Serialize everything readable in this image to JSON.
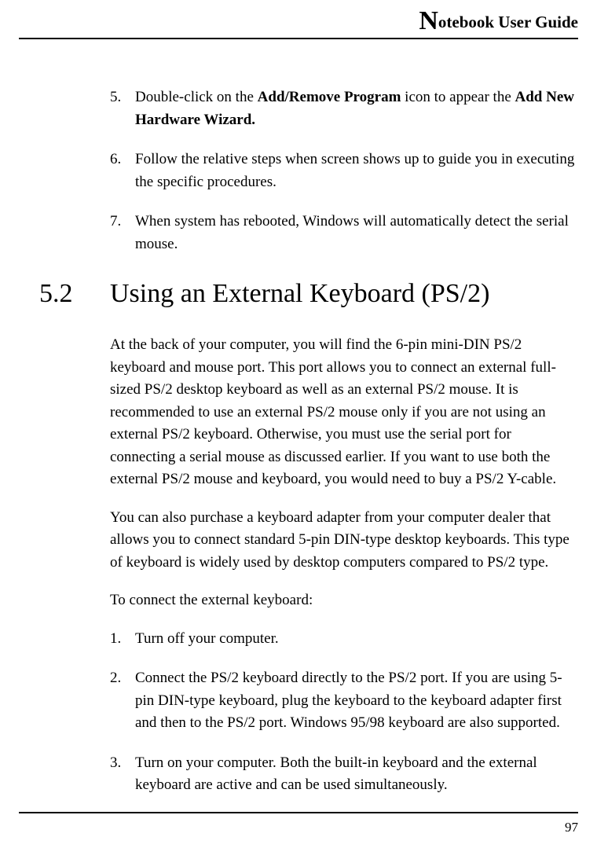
{
  "header": {
    "drop_cap": "N",
    "title_rest": "otebook User Guide"
  },
  "top_list": [
    {
      "num": "5.",
      "pre": "Double-click on the ",
      "bold1": "Add/Remove Program",
      "mid": " icon to appear the ",
      "bold2": "Add New Hardware Wizard.",
      "post": ""
    },
    {
      "num": "6.",
      "text": "Follow the relative steps when screen shows up to guide you in executing the specific procedures."
    },
    {
      "num": "7.",
      "text": "When system has rebooted, Windows will automatically detect the serial mouse."
    }
  ],
  "section": {
    "number": "5.2",
    "title": "Using an External Keyboard (PS/2)"
  },
  "paragraphs": [
    "At the back of your computer, you will find the 6-pin mini-DIN PS/2 keyboard and mouse port. This port allows you to connect an external full-sized PS/2 desktop keyboard as well as an external PS/2 mouse. It is recommended to use an external PS/2 mouse only if you are not using an external PS/2 keyboard. Otherwise, you must use the serial port for connecting a serial mouse as discussed earlier. If you want to use both the external PS/2 mouse and keyboard, you would need to buy a PS/2 Y-cable.",
    "You can also purchase a keyboard adapter from your computer dealer that allows you to connect standard 5-pin DIN-type desktop keyboards. This type of keyboard is widely used by desktop computers compared to PS/2 type.",
    "To connect the external keyboard:"
  ],
  "bottom_list": [
    {
      "num": "1.",
      "text": "Turn off your computer."
    },
    {
      "num": "2.",
      "text": "Connect the PS/2 keyboard directly to the PS/2 port. If you are using 5-pin DIN-type keyboard, plug the keyboard to the keyboard adapter first and then to the PS/2 port. Windows 95/98 keyboard are also supported."
    },
    {
      "num": "3.",
      "text": "Turn on your computer. Both the built-in keyboard and the external keyboard are active and can be used simultaneously."
    }
  ],
  "page_number": "97"
}
